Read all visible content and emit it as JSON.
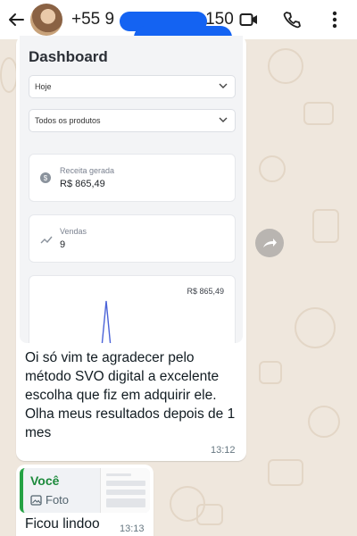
{
  "header": {
    "phone_prefix": "+55 9",
    "phone_suffix": "150",
    "icons": [
      "back-arrow-icon",
      "video-call-icon",
      "voice-call-icon",
      "more-options-icon"
    ]
  },
  "message": {
    "screenshot": {
      "title": "Dashboard",
      "period_select": "Hoje",
      "product_select": "Todos os produtos",
      "revenue": {
        "label": "Receita gerada",
        "value": "R$ 865,49"
      },
      "sales": {
        "label": "Vendas",
        "value": "9"
      },
      "chart_label": "R$ 865,49"
    },
    "text": "Oi só vim te agradecer pelo método SVO digital a excelente escolha que fiz em adquirir ele. Olha meus resultados depois de 1 mes",
    "time": "13:12"
  },
  "reply": {
    "quote_author": "Você",
    "quote_type": "Foto",
    "text": "Ficou lindoo",
    "time": "13:13"
  },
  "colors": {
    "chat_background": "#efe7dd",
    "quote_accent": "#25a244",
    "redaction": "#1463f2"
  }
}
